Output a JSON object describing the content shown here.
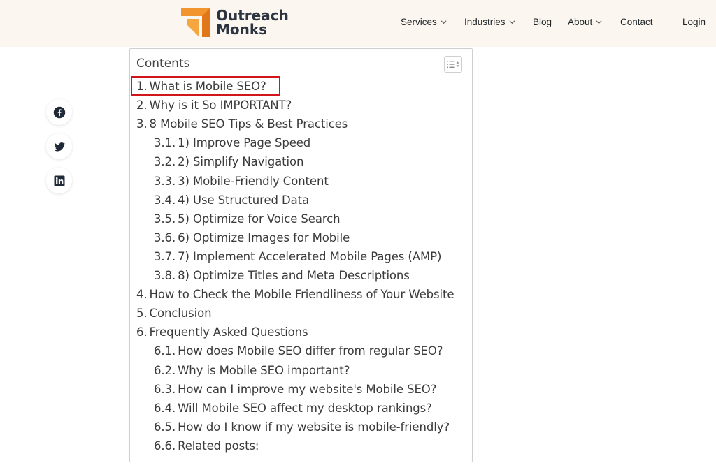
{
  "brand": {
    "line1": "Outreach",
    "line2": "Monks",
    "logo_icon": "outreach-monks-logo-icon"
  },
  "nav": [
    {
      "label": "Services",
      "dropdown": true
    },
    {
      "label": "Industries",
      "dropdown": true
    },
    {
      "label": "Blog",
      "dropdown": false
    },
    {
      "label": "About",
      "dropdown": true
    },
    {
      "label": "Contact",
      "dropdown": false
    },
    {
      "label": "Login",
      "dropdown": false
    }
  ],
  "social": [
    "facebook-icon",
    "twitter-icon",
    "linkedin-icon"
  ],
  "toc": {
    "title": "Contents",
    "toggle_icon": "list-toggle-icon",
    "items": [
      {
        "num": "1.",
        "label": "What is Mobile SEO?",
        "level": 1
      },
      {
        "num": "2.",
        "label": "Why is it So IMPORTANT?",
        "level": 1
      },
      {
        "num": "3.",
        "label": "8 Mobile SEO Tips & Best Practices",
        "level": 1
      },
      {
        "num": "3.1.",
        "label": "1) Improve Page Speed",
        "level": 2
      },
      {
        "num": "3.2.",
        "label": "2) Simplify Navigation",
        "level": 2
      },
      {
        "num": "3.3.",
        "label": "3) Mobile-Friendly Content",
        "level": 2
      },
      {
        "num": "3.4.",
        "label": "4) Use Structured Data",
        "level": 2
      },
      {
        "num": "3.5.",
        "label": "5) Optimize for Voice Search",
        "level": 2
      },
      {
        "num": "3.6.",
        "label": "6) Optimize Images for Mobile",
        "level": 2
      },
      {
        "num": "3.7.",
        "label": "7) Implement Accelerated Mobile Pages (AMP)",
        "level": 2
      },
      {
        "num": "3.8.",
        "label": "8) Optimize Titles and Meta Descriptions",
        "level": 2
      },
      {
        "num": "4.",
        "label": "How to Check the Mobile Friendliness of Your Website",
        "level": 1
      },
      {
        "num": "5.",
        "label": "Conclusion",
        "level": 1
      },
      {
        "num": "6.",
        "label": "Frequently Asked Questions",
        "level": 1
      },
      {
        "num": "6.1.",
        "label": "How does Mobile SEO differ from regular SEO?",
        "level": 2
      },
      {
        "num": "6.2.",
        "label": "Why is Mobile SEO important?",
        "level": 2
      },
      {
        "num": "6.3.",
        "label": "How can I improve my website's Mobile SEO?",
        "level": 2
      },
      {
        "num": "6.4.",
        "label": "Will Mobile SEO affect my desktop rankings?",
        "level": 2
      },
      {
        "num": "6.5.",
        "label": "How do I know if my website is mobile-friendly?",
        "level": 2
      },
      {
        "num": "6.6.",
        "label": "Related posts:",
        "level": 2
      }
    ]
  },
  "colors": {
    "header_bg": "#fbf6ef",
    "brand_orange": "#f2952f",
    "highlight": "#d0161b"
  }
}
